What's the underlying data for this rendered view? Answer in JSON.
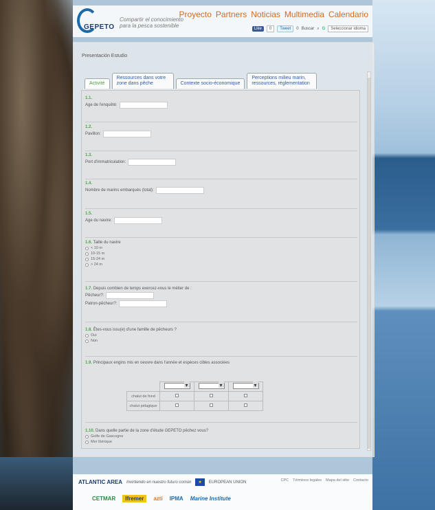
{
  "header": {
    "brand": "GEPETO",
    "tagline1": "Compartir el conocimiento",
    "tagline2": "para la pesca sostenible",
    "nav": [
      "Proyecto",
      "Partners",
      "Noticias",
      "Multimedia",
      "Calendario"
    ],
    "social": {
      "like": "Like",
      "like_count": "0",
      "tweet": "Tweet",
      "share": "0",
      "search": "Buscar",
      "lang": "Seleccionar idioma"
    }
  },
  "crumb": "Presentación Estudio",
  "tabs": [
    "Activité",
    "Ressources dans votre zone dans pêche",
    "Contexte socio-économique",
    "Perceptions milieu marin, ressources, réglementation"
  ],
  "questions": {
    "q11": {
      "num": "1.1.",
      "label": "Age de l'enquêté:"
    },
    "q12": {
      "num": "1.2.",
      "label": "Pavillon:"
    },
    "q13": {
      "num": "1.3.",
      "label": "Port d'immatriculation:"
    },
    "q14": {
      "num": "1.4.",
      "label": "Nombre de marins embarqués (total):"
    },
    "q15": {
      "num": "1.5.",
      "label": "Age du navire:"
    },
    "q16": {
      "num": "1.6.",
      "label": "Taille du navire",
      "options": [
        "< 10 m",
        "10-15 m",
        "15-24 m",
        "> 24 m"
      ]
    },
    "q17": {
      "num": "1.7.",
      "label": "Depuis combien de temps exercez-vous le métier de :",
      "sub1": "Pêcheur?:",
      "sub2": "Patron-pêcheur?:"
    },
    "q18": {
      "num": "1.8.",
      "label": "Êtes-vous issu(e) d'une famille de pêcheurs ?",
      "options": [
        "Oui",
        "Non"
      ]
    },
    "q19": {
      "num": "1.9.",
      "label": "Principaux engins mis en oeuvre dans l'année et espèces cibles associées",
      "row1": "chalut de fond",
      "row2": "chalut pélagique"
    },
    "q110": {
      "num": "1.10.",
      "label": "Dans quelle partie de la zone d'étude GEPETO pêchez vous?",
      "options": [
        "Golfe de Gascogne",
        "Mer Ibérique"
      ]
    }
  },
  "footer": {
    "atlantic": "ATLANTIC AREA",
    "slogan": "Invirtiendo en nuestro futuro común",
    "eu": "EUROPEAN UNION",
    "links": [
      "CPC",
      "Términos legales",
      "Mapa del sitio",
      "Contacto"
    ],
    "partners": [
      "CETMAR",
      "Ifremer",
      "azti",
      "IPMA",
      "Marine Institute"
    ]
  }
}
